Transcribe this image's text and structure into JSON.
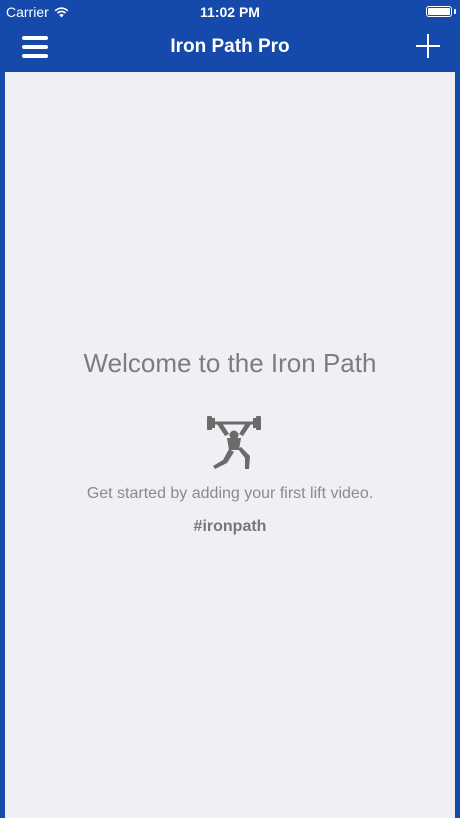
{
  "status_bar": {
    "carrier": "Carrier",
    "time": "11:02 PM",
    "battery_level": 1.0
  },
  "nav_bar": {
    "title": "Iron Path Pro",
    "menu_icon": "hamburger-menu-icon",
    "add_icon": "plus-icon"
  },
  "empty_state": {
    "title": "Welcome to the Iron Path",
    "icon": "weightlifter-icon",
    "message": "Get started by adding your first lift video.",
    "hashtag": "#ironpath"
  },
  "colors": {
    "nav_background": "#1549ac",
    "content_background": "#efeff4",
    "text_muted": "#7d7d7d"
  }
}
